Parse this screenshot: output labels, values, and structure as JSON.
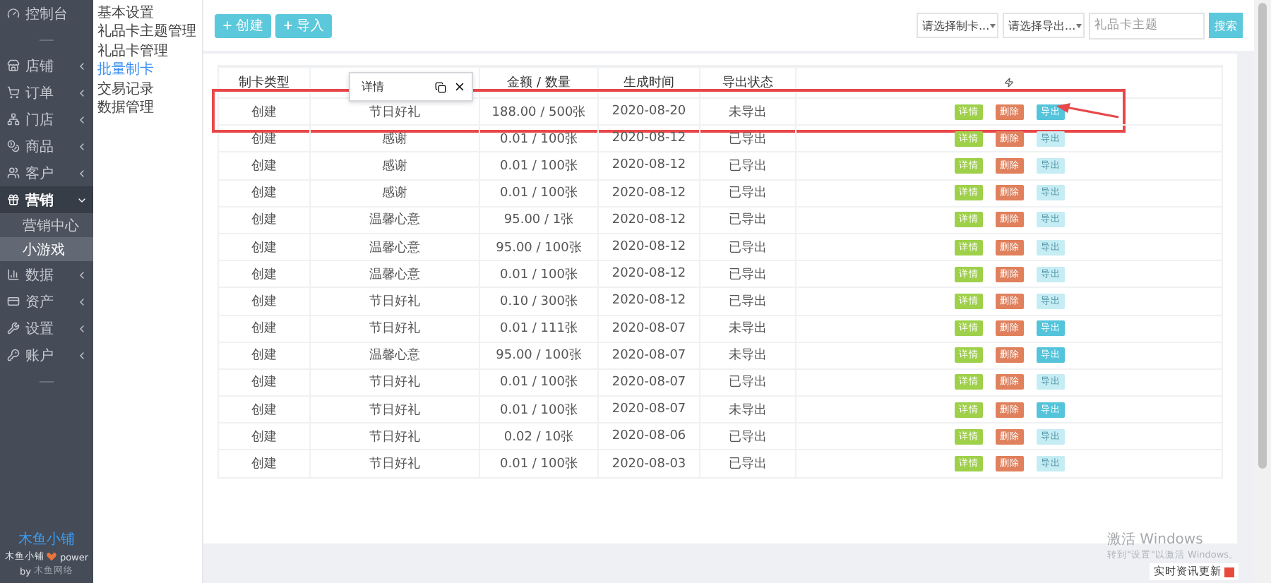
{
  "sidebar": {
    "items": [
      {
        "label": "控制台",
        "selected": false
      },
      {
        "label": "店铺",
        "selected": false,
        "expanded": false
      },
      {
        "label": "订单",
        "selected": false,
        "expanded": false
      },
      {
        "label": "门店",
        "selected": false,
        "expanded": false
      },
      {
        "label": "商品",
        "selected": false,
        "expanded": false
      },
      {
        "label": "客户",
        "selected": false,
        "expanded": false
      },
      {
        "label": "营销",
        "selected": true,
        "expanded": true,
        "children": [
          {
            "label": "营销中心",
            "selected": false
          },
          {
            "label": "小游戏",
            "selected": true
          }
        ]
      },
      {
        "label": "数据",
        "selected": false,
        "expanded": false
      },
      {
        "label": "资产",
        "selected": false,
        "expanded": false
      },
      {
        "label": "设置",
        "selected": false,
        "expanded": false
      },
      {
        "label": "账户",
        "selected": false,
        "expanded": false
      }
    ],
    "footer": {
      "brand": "木鱼小铺",
      "power_prefix": "木鱼小铺",
      "power_suffix": "power",
      "by": "by",
      "company": "木鱼网络"
    }
  },
  "submenu": {
    "items": [
      {
        "label": "基本设置",
        "selected": false
      },
      {
        "label": "礼品卡主题管理",
        "selected": false
      },
      {
        "label": "礼品卡管理",
        "selected": false
      },
      {
        "label": "批量制卡",
        "selected": true
      },
      {
        "label": "交易记录",
        "selected": false
      },
      {
        "label": "数据管理",
        "selected": false
      }
    ]
  },
  "toolbar": {
    "buttons": [
      "创建",
      "导入"
    ],
    "filters": [
      "请选择制卡...",
      "请选择导出..."
    ],
    "search": {
      "placeholder": "礼品卡主题"
    },
    "search_button": "搜索"
  },
  "table": {
    "columns": [
      "制卡类型",
      "",
      "金额 / 数量",
      "生成时间",
      "导出状态",
      ""
    ],
    "tooltip": {
      "text": "详情"
    },
    "rows": [
      {
        "type": "创建",
        "name": "节日好礼",
        "amount": "188.00 / 500张",
        "date": "2020-08-20",
        "status": "未导出",
        "export_enabled": true,
        "highlighted": true,
        "actions": [
          "详情",
          "删除",
          "导出"
        ]
      },
      {
        "type": "创建",
        "name": "感谢",
        "amount": "0.01 / 100张",
        "date": "2020-08-12",
        "status": "已导出",
        "export_enabled": false,
        "actions": [
          "详情",
          "删除",
          "导出"
        ]
      },
      {
        "type": "创建",
        "name": "感谢",
        "amount": "0.01 / 100张",
        "date": "2020-08-12",
        "status": "已导出",
        "export_enabled": false,
        "actions": [
          "详情",
          "删除",
          "导出"
        ]
      },
      {
        "type": "创建",
        "name": "感谢",
        "amount": "0.01 / 100张",
        "date": "2020-08-12",
        "status": "已导出",
        "export_enabled": false,
        "actions": [
          "详情",
          "删除",
          "导出"
        ]
      },
      {
        "type": "创建",
        "name": "温馨心意",
        "amount": "95.00 / 1张",
        "date": "2020-08-12",
        "status": "已导出",
        "export_enabled": false,
        "actions": [
          "详情",
          "删除",
          "导出"
        ]
      },
      {
        "type": "创建",
        "name": "温馨心意",
        "amount": "95.00 / 100张",
        "date": "2020-08-12",
        "status": "已导出",
        "export_enabled": false,
        "actions": [
          "详情",
          "删除",
          "导出"
        ]
      },
      {
        "type": "创建",
        "name": "温馨心意",
        "amount": "0.01 / 100张",
        "date": "2020-08-12",
        "status": "已导出",
        "export_enabled": false,
        "actions": [
          "详情",
          "删除",
          "导出"
        ]
      },
      {
        "type": "创建",
        "name": "节日好礼",
        "amount": "0.10 / 300张",
        "date": "2020-08-12",
        "status": "已导出",
        "export_enabled": false,
        "actions": [
          "详情",
          "删除",
          "导出"
        ]
      },
      {
        "type": "创建",
        "name": "节日好礼",
        "amount": "0.01 / 111张",
        "date": "2020-08-07",
        "status": "未导出",
        "export_enabled": true,
        "actions": [
          "详情",
          "删除",
          "导出"
        ]
      },
      {
        "type": "创建",
        "name": "温馨心意",
        "amount": "95.00 / 100张",
        "date": "2020-08-07",
        "status": "未导出",
        "export_enabled": true,
        "actions": [
          "详情",
          "删除",
          "导出"
        ]
      },
      {
        "type": "创建",
        "name": "节日好礼",
        "amount": "0.01 / 100张",
        "date": "2020-08-07",
        "status": "已导出",
        "export_enabled": false,
        "actions": [
          "详情",
          "删除",
          "导出"
        ]
      },
      {
        "type": "创建",
        "name": "节日好礼",
        "amount": "0.01 / 100张",
        "date": "2020-08-07",
        "status": "未导出",
        "export_enabled": true,
        "actions": [
          "详情",
          "删除",
          "导出"
        ]
      },
      {
        "type": "创建",
        "name": "节日好礼",
        "amount": "0.02 / 10张",
        "date": "2020-08-06",
        "status": "已导出",
        "export_enabled": false,
        "actions": [
          "详情",
          "删除",
          "导出"
        ]
      },
      {
        "type": "创建",
        "name": "节日好礼",
        "amount": "0.01 / 100张",
        "date": "2020-08-03",
        "status": "已导出",
        "export_enabled": false,
        "actions": [
          "详情",
          "删除",
          "导出"
        ]
      }
    ]
  },
  "system": {
    "activation_title": "激活 Windows",
    "activation_hint": "转到\"设置\"以激活 Windows。",
    "news": "实时资讯更新"
  }
}
